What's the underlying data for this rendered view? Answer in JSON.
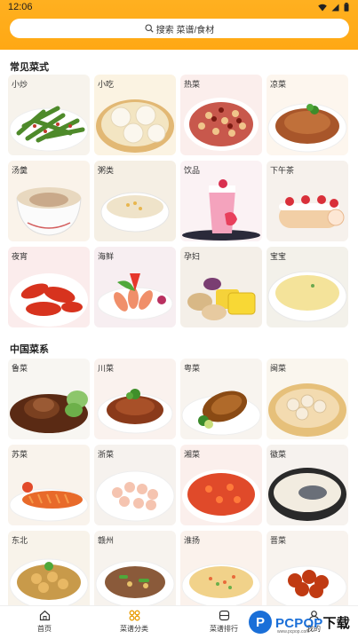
{
  "status_bar": {
    "time": "12:06"
  },
  "search": {
    "label": "搜索 菜谱/食材"
  },
  "sections": [
    {
      "title": "常见菜式",
      "items": [
        {
          "label": "小炒",
          "img": "greenbeans"
        },
        {
          "label": "小吃",
          "img": "dumplings"
        },
        {
          "label": "热菜",
          "img": "peanutchili"
        },
        {
          "label": "凉菜",
          "img": "coldmeat"
        },
        {
          "label": "汤羹",
          "img": "soup"
        },
        {
          "label": "粥类",
          "img": "porridge"
        },
        {
          "label": "饮品",
          "img": "drink"
        },
        {
          "label": "下午茶",
          "img": "cake"
        },
        {
          "label": "夜宵",
          "img": "crayfish"
        },
        {
          "label": "海鲜",
          "img": "shrimpplate"
        },
        {
          "label": "孕妇",
          "img": "sweetpotato"
        },
        {
          "label": "宝宝",
          "img": "custard"
        }
      ]
    },
    {
      "title": "中国菜系",
      "items": [
        {
          "label": "鲁菜",
          "img": "seacucumber"
        },
        {
          "label": "川菜",
          "img": "braisedmeat"
        },
        {
          "label": "粤菜",
          "img": "roastgoose"
        },
        {
          "label": "闽菜",
          "img": "fotiaoqiang"
        },
        {
          "label": "苏菜",
          "img": "squirrelfish"
        },
        {
          "label": "浙菜",
          "img": "shrimp"
        },
        {
          "label": "湘菜",
          "img": "fishhead"
        },
        {
          "label": "徽菜",
          "img": "fishsoup"
        },
        {
          "label": "东北",
          "img": "stew"
        },
        {
          "label": "赣州",
          "img": "stirfry"
        },
        {
          "label": "淮扬",
          "img": "friedrice"
        },
        {
          "label": "晋菜",
          "img": "sweetsour"
        }
      ]
    }
  ],
  "tabs": [
    {
      "label": "首页",
      "icon": "home-icon"
    },
    {
      "label": "菜谱分类",
      "icon": "category-icon"
    },
    {
      "label": "菜谱排行",
      "icon": "ranking-icon"
    },
    {
      "label": "我的",
      "icon": "profile-icon"
    }
  ],
  "watermark": {
    "logo": "P",
    "brand": "PCPOP",
    "suffix": "下载",
    "sub": "www.pcpop.com"
  },
  "colors": {
    "header": "#ffa814",
    "accent_underline": "#ffb020"
  }
}
